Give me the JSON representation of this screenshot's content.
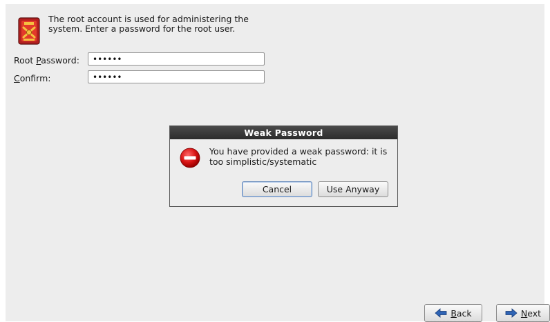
{
  "header": {
    "description": "The root account is used for administering the system.  Enter a password for the root user.",
    "icon": "root-shield-icon"
  },
  "form": {
    "root_password_label": "Root Password:",
    "root_password_mnemonic": "P",
    "root_password_value": "••••••",
    "confirm_label": "Confirm:",
    "confirm_mnemonic": "C",
    "confirm_value": "••••••"
  },
  "dialog": {
    "title": "Weak Password",
    "message": "You have provided a weak password: it is too simplistic/systematic",
    "icon": "error-icon",
    "cancel_label": "Cancel",
    "use_anyway_label": "Use Anyway"
  },
  "nav": {
    "back_label": "Back",
    "next_label": "Next",
    "back_icon": "arrow-left-icon",
    "next_icon": "arrow-right-icon"
  },
  "colors": {
    "panel": "#ededed",
    "dialog_title_bg": "#2c2c2c",
    "error_red": "#cc0000",
    "arrow_blue": "#2f64b5"
  }
}
